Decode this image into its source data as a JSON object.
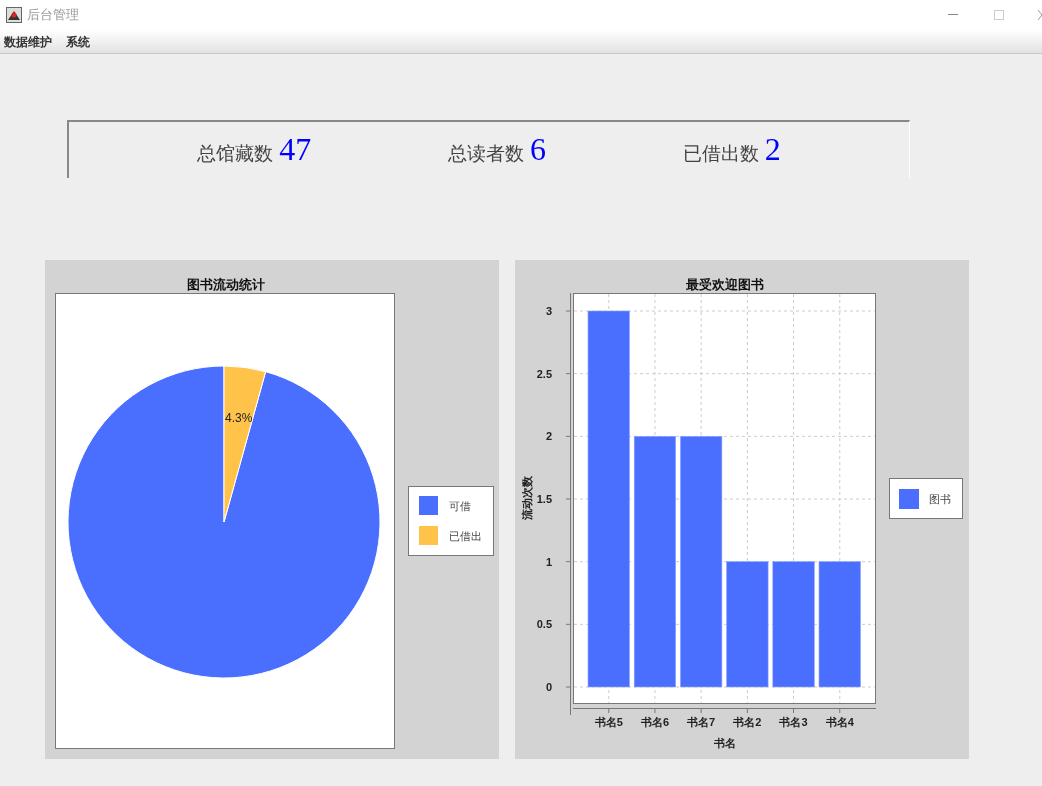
{
  "window": {
    "title": "后台管理"
  },
  "menu": [
    {
      "label": "数据维护"
    },
    {
      "label": "系统"
    }
  ],
  "stats": [
    {
      "label": "总馆藏数",
      "value": "47"
    },
    {
      "label": "总读者数",
      "value": "6"
    },
    {
      "label": "已借出数",
      "value": "2"
    }
  ],
  "pie_panel": {
    "chart_data": {
      "type": "pie",
      "title": "图书流动统计",
      "legend": true,
      "categories": [
        "可借",
        "已借出"
      ],
      "values": [
        95.7,
        4.3
      ],
      "value_labels": [
        null,
        "4.3%"
      ]
    }
  },
  "bar_panel": {
    "chart_data": {
      "type": "bar",
      "title": "最受欢迎图书",
      "xlabel": "书名",
      "ylabel": "流动次数",
      "categories": [
        "书名5",
        "书名6",
        "书名7",
        "书名2",
        "书名3",
        "书名4"
      ],
      "series": [
        {
          "name": "图书",
          "color": "#4a6fff",
          "values": [
            3,
            2,
            2,
            1,
            1,
            1
          ]
        }
      ],
      "grid": true,
      "legend": true,
      "ylim": [
        0,
        3
      ],
      "yticks": [
        0,
        {
          "value": 0.5,
          "label": "0.5"
        },
        1,
        {
          "value": 1.5,
          "label": "1.5"
        },
        2,
        {
          "value": 2.5,
          "label": "2.5"
        },
        3
      ]
    }
  }
}
